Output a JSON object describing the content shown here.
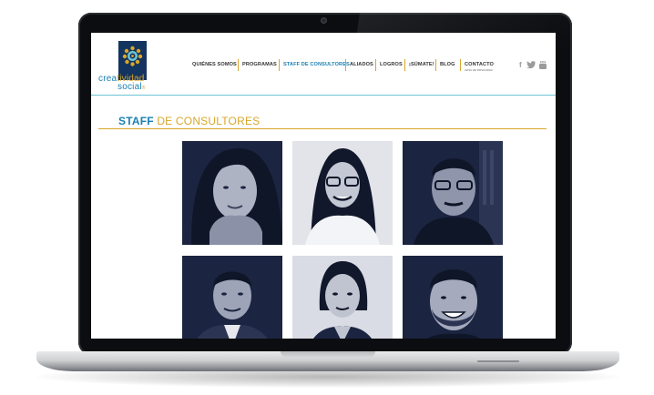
{
  "site": {
    "logo": {
      "line1_blue": "crea",
      "line1_gold": "tividad",
      "line2_blue": "social",
      "trademark": "®"
    },
    "nav": {
      "items": [
        {
          "label": "QUIÉNES SOMOS",
          "active": false
        },
        {
          "label": "PROGRAMAS",
          "active": false
        },
        {
          "label": "STAFF DE CONSULTORES",
          "active": true
        },
        {
          "label": "ALIADOS",
          "active": false
        },
        {
          "label": "LOGROS",
          "active": false
        },
        {
          "label": "¡SÚMATE!",
          "active": false
        },
        {
          "label": "BLOG",
          "active": false
        },
        {
          "label": "CONTACTO",
          "active": false
        }
      ],
      "contact_sub": "AVISO DE PRIVACIDAD"
    },
    "social": {
      "facebook": "f",
      "twitter": "twitter-icon",
      "youtube": "youtube-icon"
    }
  },
  "page": {
    "title_blue": "STAFF",
    "title_gold": " DE CONSULTORES"
  },
  "consultants": [
    {
      "photo": "woman-long-hair-portrait"
    },
    {
      "photo": "woman-glasses-portrait"
    },
    {
      "photo": "man-glasses-portrait"
    },
    {
      "photo": "man-suit-portrait"
    },
    {
      "photo": "woman-hair-tied-portrait"
    },
    {
      "photo": "man-beard-smiling-portrait"
    }
  ],
  "colors": {
    "accent_blue": "#1a7fb0",
    "accent_gold": "#d8a72a",
    "photo_tint_dark": "#1b2440",
    "photo_tint_light": "#c9ccd6",
    "laptop_bezel": "#0c0d10"
  }
}
